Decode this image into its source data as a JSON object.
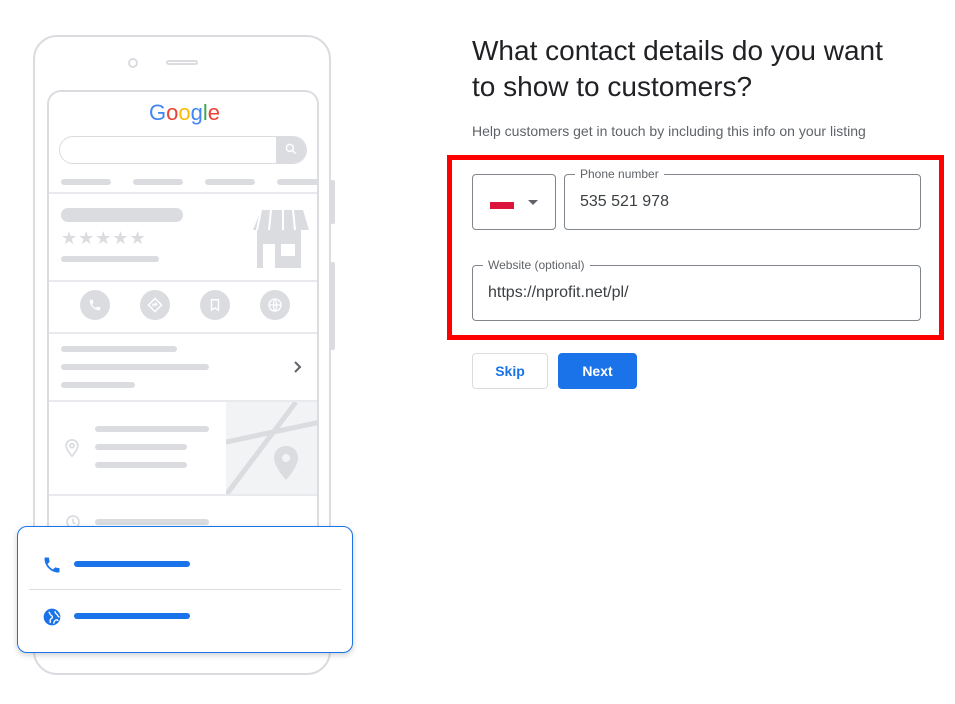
{
  "illustration": {
    "logo_letters": [
      {
        "char": "G",
        "color": "#4285f4"
      },
      {
        "char": "o",
        "color": "#ea4335"
      },
      {
        "char": "o",
        "color": "#fbbc05"
      },
      {
        "char": "g",
        "color": "#4285f4"
      },
      {
        "char": "l",
        "color": "#34a853"
      },
      {
        "char": "e",
        "color": "#ea4335"
      }
    ],
    "rating_stars": 5,
    "action_icons": [
      "phone-icon",
      "directions-icon",
      "bookmark-icon",
      "globe-icon"
    ],
    "card_icons": [
      "phone-icon",
      "globe-icon"
    ]
  },
  "form": {
    "title": "What contact details do you want to show to customers?",
    "subtitle": "Help customers get in touch by including this info on your listing",
    "country_flag": "poland-flag",
    "phone_label": "Phone number",
    "phone_value": "535 521 978",
    "website_label": "Website (optional)",
    "website_value": "https://nprofit.net/pl/",
    "skip_label": "Skip",
    "next_label": "Next"
  },
  "colors": {
    "accent": "#1a73e8",
    "highlight": "#ff0000",
    "placeholder_gray": "#dadce0"
  }
}
